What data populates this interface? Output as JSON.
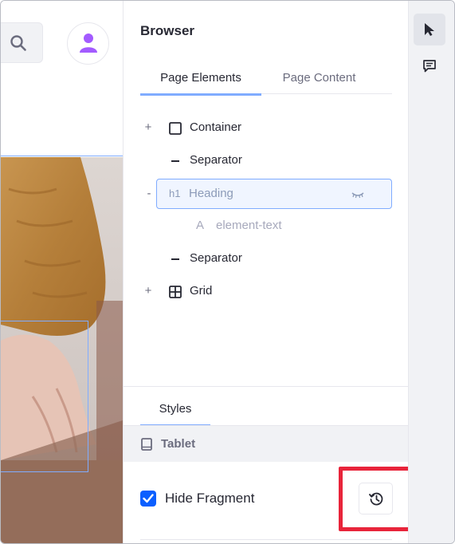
{
  "panel": {
    "title": "Browser",
    "tabs": [
      {
        "label": "Page Elements",
        "active": true
      },
      {
        "label": "Page Content",
        "active": false
      }
    ]
  },
  "tree": [
    {
      "toggle": "+",
      "icon": "square-container-icon",
      "label": "Container"
    },
    {
      "toggle": "",
      "icon": "separator-dash-icon",
      "label": "Separator"
    },
    {
      "toggle": "-",
      "icon": "heading-h1-icon",
      "icon_text": "h1",
      "label": "Heading",
      "selected": true
    },
    {
      "toggle": "",
      "icon": "text-a-icon",
      "icon_text": "A",
      "label": "element-text",
      "dim": true
    },
    {
      "toggle": "",
      "icon": "separator-dash-icon",
      "label": "Separator"
    },
    {
      "toggle": "+",
      "icon": "grid-icon",
      "label": "Grid"
    }
  ],
  "styles": {
    "tab_label": "Styles",
    "device_label": "Tablet",
    "hide_fragment_label": "Hide Fragment",
    "hide_fragment_checked": true
  },
  "colors": {
    "accent": "#0b5fff",
    "selection": "#80acff",
    "highlight": "#e8243a",
    "avatar": "#a35bff"
  }
}
